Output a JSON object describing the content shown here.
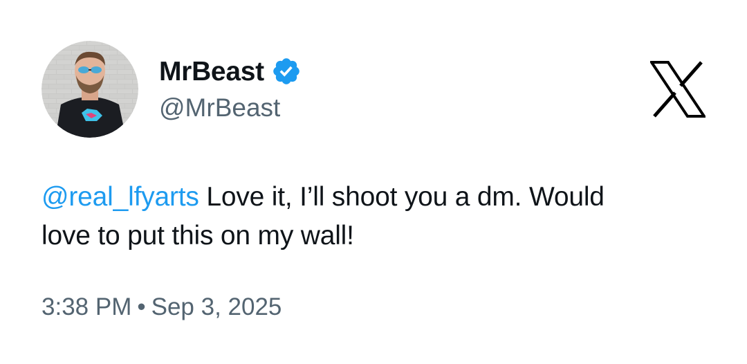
{
  "author": {
    "display_name": "MrBeast",
    "handle": "@MrBeast",
    "verified": true,
    "avatar_icon": "profile-photo"
  },
  "tweet": {
    "mention": "@real_lfyarts",
    "text_line1": " Love it, I’ll shoot you a dm. Would",
    "text_line2": "love to put this on my wall!",
    "time": "3:38 PM",
    "separator": "•",
    "date": "Sep 3, 2025"
  },
  "brand": {
    "logo_icon": "x-logo-icon"
  },
  "colors": {
    "text": "#0f1419",
    "secondary": "#536471",
    "accent": "#1d9bf0"
  }
}
